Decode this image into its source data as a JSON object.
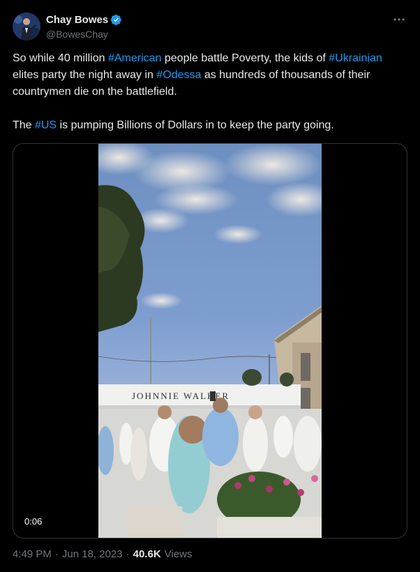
{
  "author": {
    "name": "Chay Bowes",
    "handle": "@BowesChay",
    "verified_color": "#1d9bf0"
  },
  "tweet": {
    "p1_t1": "So while 40 million ",
    "p1_h1": "#American",
    "p1_t2": " people battle Poverty, the kids of ",
    "p1_h2": "#Ukrainian",
    "p1_t3": " elites party the night away in ",
    "p1_h3": "#Odessa",
    "p1_t4": " as hundreds of thousands of their countrymen die on the battlefield.",
    "p2_t1": "The ",
    "p2_h1": "#US",
    "p2_t2": " is pumping Billions of Dollars in to keep the party going."
  },
  "media": {
    "duration": "0:06",
    "sign_text": "JOHNNIE WALKER"
  },
  "meta": {
    "time": "4:49 PM",
    "sep1": "·",
    "date": "Jun 18, 2023",
    "sep2": "·",
    "views_count": "40.6K",
    "views_label": "Views"
  },
  "colors": {
    "background": "#000000",
    "text": "#e7e9ea",
    "secondary": "#71767b",
    "link": "#1d9bf0",
    "border": "#2f3336"
  },
  "icons": [
    "verified-badge-icon",
    "more-options-icon",
    "avatar-image"
  ]
}
